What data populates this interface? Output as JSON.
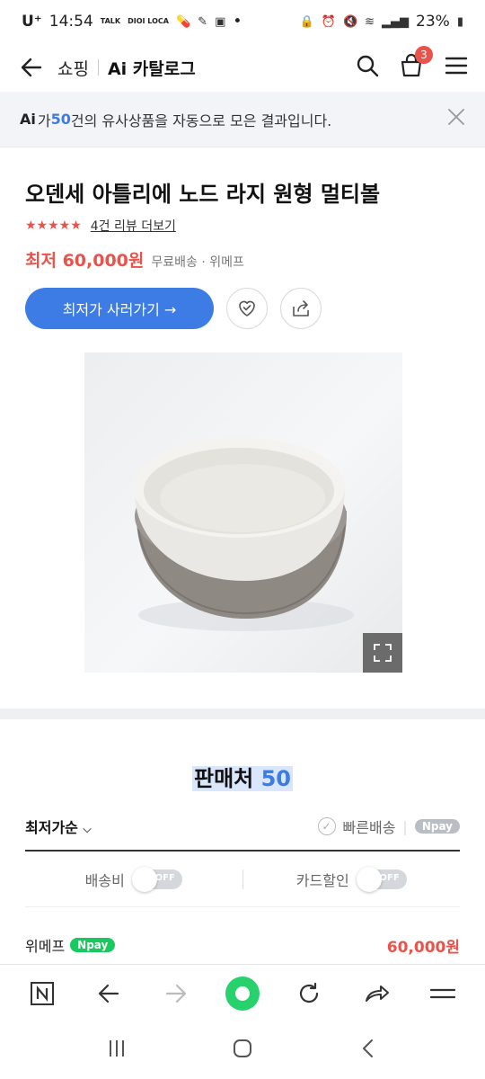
{
  "status_bar": {
    "carrier": "U⁺",
    "time": "14:54",
    "talk_label": "TALK",
    "dioi_label": "DIOI LOCA",
    "dot": "•",
    "battery": "23%"
  },
  "header": {
    "section": "쇼핑",
    "title": "Ai 카탈로그",
    "cart_count": "3"
  },
  "ai_banner": {
    "logo": "Ai",
    "prefix": "가 ",
    "count": "50",
    "suffix": "건의 유사상품을 자동으로 모은 결과입니다."
  },
  "product": {
    "title": "오덴세 아틀리에 노드 라지 원형 멀티볼",
    "stars": "★★★★★",
    "review_link": "4건 리뷰 더보기",
    "price": "최저 60,000원",
    "shipping": "무료배송 · 위메프",
    "buy_button": "최저가 사러가기 →"
  },
  "sellers": {
    "heading_label": "판매처",
    "heading_count": "50",
    "sort_label": "최저가순",
    "fast_delivery": "빠른배송",
    "npay": "Npay",
    "filter_shipping": "배송비",
    "filter_card": "카드할인",
    "toggle_off": "OFF",
    "rows": [
      {
        "name": "위메프",
        "pay": "Npay",
        "price": "60,000원"
      }
    ]
  },
  "icons": {
    "back": "arrow-left-icon",
    "search": "search-icon",
    "cart": "shopping-bag-icon",
    "menu": "hamburger-icon",
    "close": "close-icon",
    "wishlist": "heart-check-icon",
    "share": "share-icon",
    "expand": "expand-icon"
  },
  "colors": {
    "accent_blue": "#3d7be5",
    "price_red": "#e8544b",
    "npay_green": "#19c85e",
    "banner_bg": "#f2f4f7"
  }
}
